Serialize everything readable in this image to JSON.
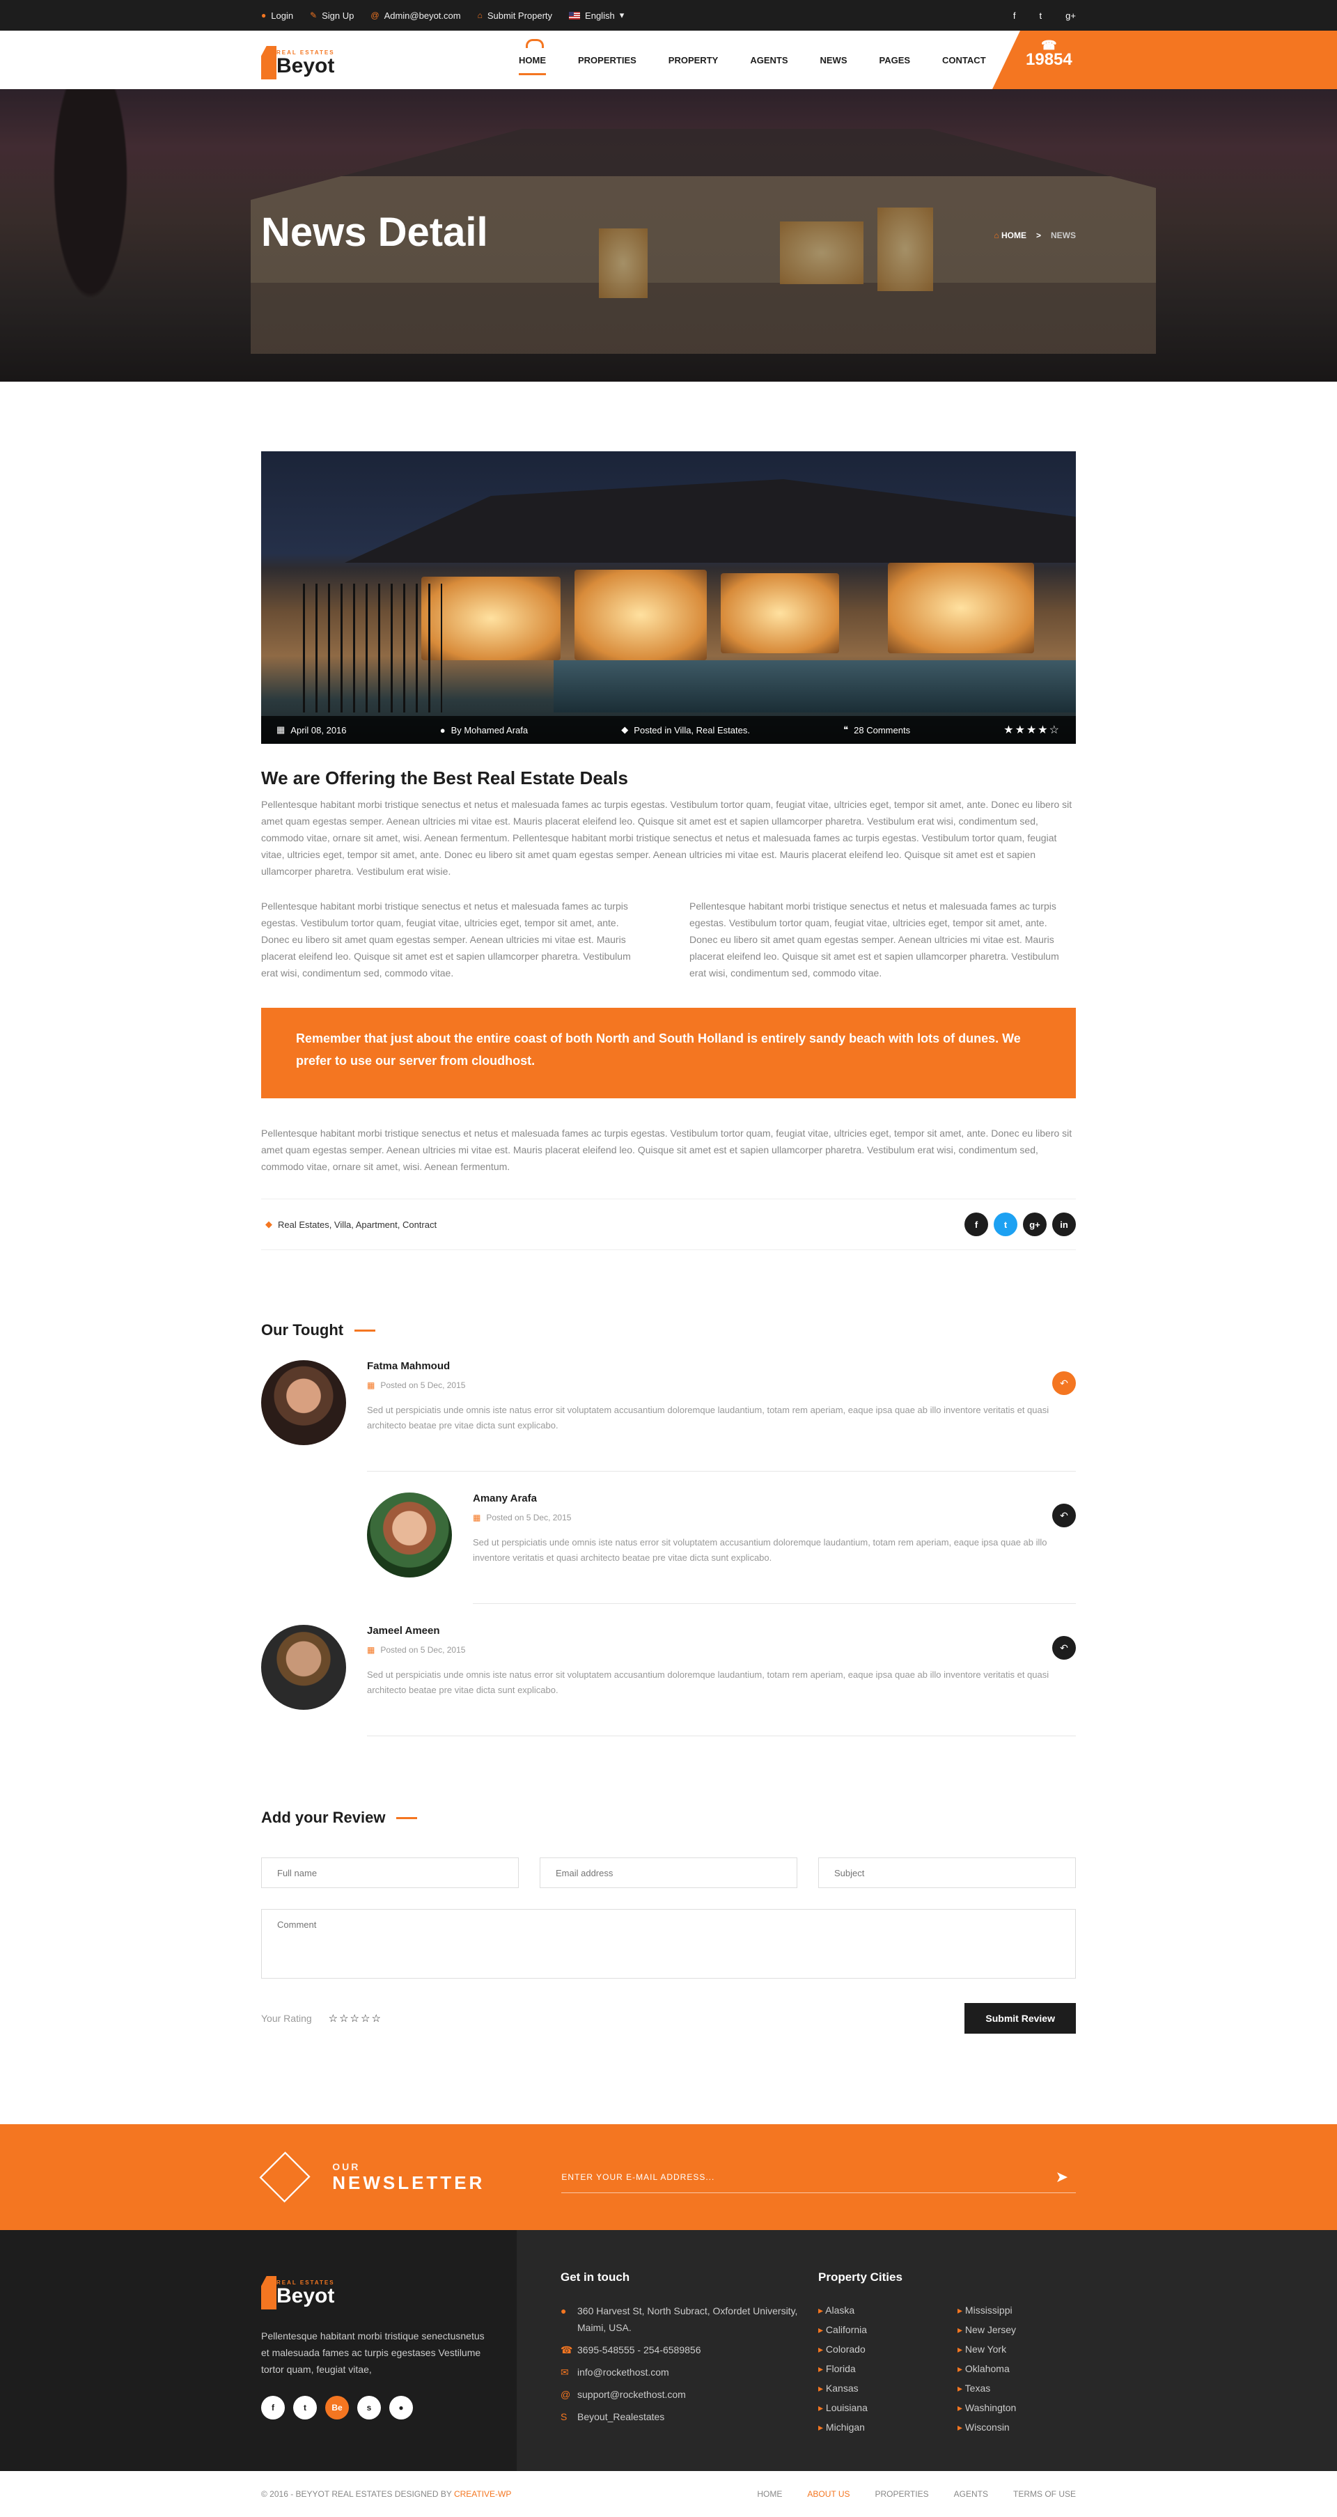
{
  "topbar": {
    "login": "Login",
    "signup": "Sign Up",
    "email": "Admin@beyot.com",
    "submit": "Submit Property",
    "language": "English",
    "social": [
      "f",
      "t",
      "g+"
    ]
  },
  "logo": {
    "small": "REAL ESTATES",
    "name": "Beyot"
  },
  "nav": [
    "HOME",
    "PROPERTIES",
    "PROPERTY",
    "AGENTS",
    "NEWS",
    "PAGES",
    "CONTACT"
  ],
  "phone": {
    "icon": "phone-icon",
    "number": "19854"
  },
  "banner": {
    "title": "News Detail",
    "crumb_home": "HOME",
    "crumb_sep": ">",
    "crumb_current": "NEWS"
  },
  "post": {
    "date": "April 08, 2016",
    "author": "By Mohamed Arafa",
    "posted": "Posted in Villa, Real Estates.",
    "comments": "28 Comments",
    "rating_stars": "★★★★☆",
    "title": "We are Offering the Best Real Estate Deals",
    "para1": "Pellentesque habitant morbi tristique senectus et netus et malesuada fames ac turpis egestas. Vestibulum tortor quam, feugiat vitae, ultricies eget, tempor sit amet, ante. Donec eu libero sit amet quam egestas semper. Aenean ultricies mi vitae est. Mauris placerat eleifend leo. Quisque sit amet est et sapien ullamcorper pharetra. Vestibulum erat wisi, condimentum sed, commodo vitae, ornare sit amet, wisi. Aenean fermentum. Pellentesque habitant morbi tristique senectus et netus et malesuada fames ac turpis egestas. Vestibulum tortor quam, feugiat vitae, ultricies eget, tempor sit amet, ante. Donec eu libero sit amet quam egestas semper. Aenean ultricies mi vitae est. Mauris placerat eleifend leo. Quisque sit amet est et sapien ullamcorper pharetra. Vestibulum erat wisie.",
    "col1": "Pellentesque habitant morbi tristique senectus et netus et malesuada fames ac turpis egestas. Vestibulum tortor quam, feugiat vitae, ultricies eget, tempor sit amet, ante. Donec eu libero sit amet quam egestas semper. Aenean ultricies mi vitae est. Mauris placerat eleifend leo. Quisque sit amet est et sapien ullamcorper pharetra. Vestibulum erat wisi, condimentum sed, commodo vitae.",
    "col2": "Pellentesque habitant morbi tristique senectus et netus et malesuada fames ac turpis egestas. Vestibulum tortor quam, feugiat vitae, ultricies eget, tempor sit amet, ante. Donec eu libero sit amet quam egestas semper. Aenean ultricies mi vitae est. Mauris placerat eleifend leo. Quisque sit amet est et sapien ullamcorper pharetra. Vestibulum erat wisi, condimentum sed, commodo vitae.",
    "quote": "Remember that just about the entire coast of both North and South Holland is entirely sandy beach with lots of dunes.  We prefer to use our server from cloudhost.",
    "para2": "Pellentesque habitant morbi tristique senectus et netus et malesuada fames ac turpis egestas. Vestibulum tortor quam, feugiat vitae, ultricies eget, tempor sit amet, ante. Donec eu libero sit amet quam egestas semper. Aenean ultricies mi vitae est. Mauris placerat eleifend leo. Quisque sit amet est et sapien ullamcorper pharetra. Vestibulum erat wisi, condimentum sed, commodo vitae, ornare sit amet, wisi. Aenean fermentum.",
    "tags": "Real Estates, Villa, Apartment, Contract",
    "share": [
      "f",
      "t",
      "g+",
      "in"
    ]
  },
  "comments": {
    "heading": "Our Tought",
    "items": [
      {
        "name": "Fatma Mahmoud",
        "date": "Posted on 5 Dec, 2015",
        "text": "Sed ut perspiciatis unde omnis iste natus error sit voluptatem accusantium doloremque laudantium, totam rem aperiam, eaque ipsa quae ab illo inventore veritatis et quasi architecto beatae pre vitae dicta sunt explicabo."
      },
      {
        "name": "Amany Arafa",
        "date": "Posted on 5 Dec, 2015",
        "text": "Sed ut perspiciatis unde omnis iste natus error sit voluptatem accusantium doloremque laudantium, totam rem aperiam, eaque ipsa quae ab illo inventore veritatis et quasi architecto beatae pre vitae dicta sunt explicabo."
      },
      {
        "name": "Jameel Ameen",
        "date": "Posted on 5 Dec, 2015",
        "text": "Sed ut perspiciatis unde omnis iste natus error sit voluptatem accusantium doloremque laudantium, totam rem aperiam, eaque ipsa quae ab illo inventore veritatis et quasi architecto beatae pre vitae dicta sunt explicabo."
      }
    ]
  },
  "review": {
    "heading": "Add your Review",
    "fullname": "Full name",
    "email": "Email address",
    "subject": "Subject",
    "comment": "Comment",
    "rating_label": "Your Rating",
    "rating_stars": "☆☆☆☆☆",
    "submit": "Submit Review"
  },
  "newsletter": {
    "small": "OUR",
    "big": "NEWSLETTER",
    "placeholder": "ENTER YOUR E-MAIL ADDRESS..."
  },
  "footer": {
    "about": "Pellentesque habitant morbi tristique senectusnetus et malesuada fames ac turpis egestases Vestilume tortor quam, feugiat vitae,",
    "social": [
      "f",
      "t",
      "Be",
      "s",
      ""
    ],
    "contact_heading": "Get in touch",
    "address": "360 Harvest St, North Subract, Oxfordet University, Maimi,  USA.",
    "phone": "3695-548555    -   254-6589856",
    "email1": "info@rockethost.com",
    "email2": "support@rockethost.com",
    "skype": "Beyout_Realestates",
    "cities_heading": "Property Cities",
    "cities": [
      "Alaska",
      "Mississippi",
      "California",
      "New Jersey",
      "Colorado",
      "New York",
      "Florida",
      "Oklahoma",
      "Kansas",
      "Texas",
      "Louisiana",
      "Washington",
      "Michigan",
      "Wisconsin"
    ]
  },
  "copyright": {
    "text": "© 2016 - BEYYOT REAL ESTATES DESIGNED BY ",
    "brand": "CREATIVE-WP",
    "links": [
      "HOME",
      "ABOUT US",
      "PROPERTIES",
      "AGENTS",
      "TERMS OF USE"
    ]
  },
  "colors": {
    "accent": "#f47621",
    "dark": "#1d1d1d"
  }
}
